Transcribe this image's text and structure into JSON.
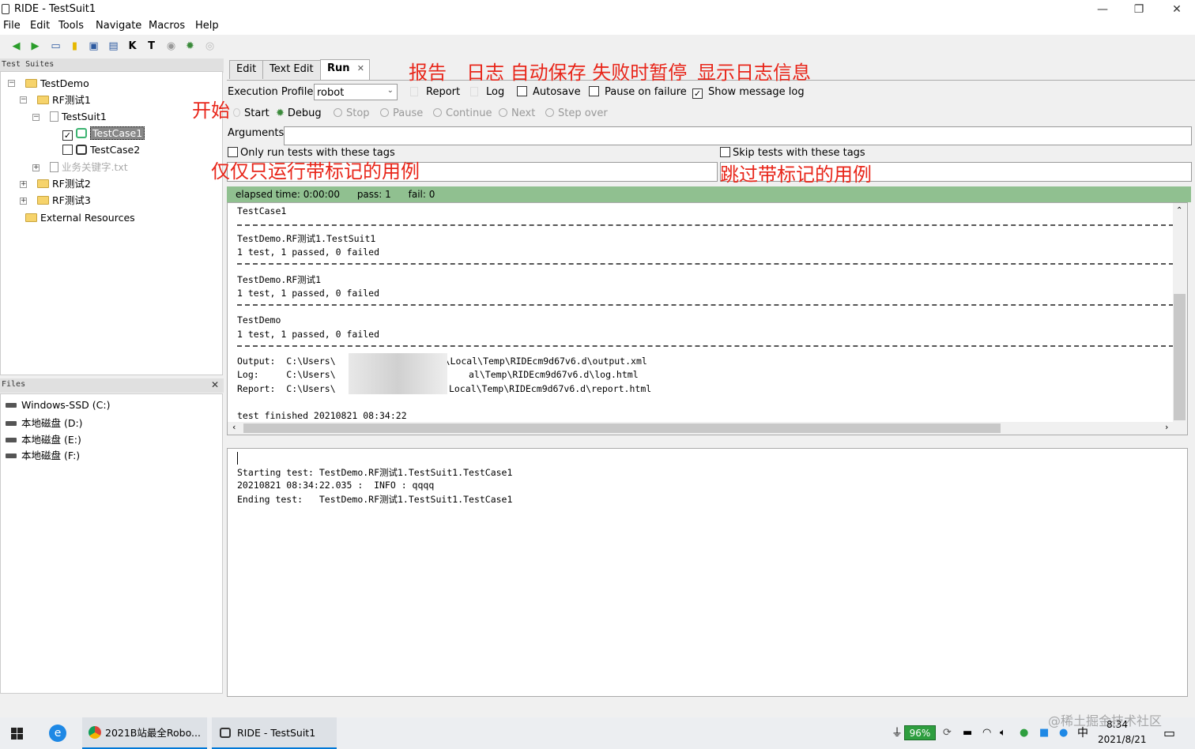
{
  "window": {
    "title": "RIDE - TestSuit1",
    "minimize": "—",
    "restore": "❐",
    "close": "✕"
  },
  "menu": [
    "File",
    "Edit",
    "Tools",
    "Navigate",
    "Macros",
    "Help"
  ],
  "left": {
    "suites_header": "Test Suites",
    "tree": {
      "testdemo": "TestDemo",
      "rf1": "RF测试1",
      "testsuit1": "TestSuit1",
      "testcase1": "TestCase1",
      "testcase2": "TestCase2",
      "keywords": "业务关键字.txt",
      "rf2": "RF测试2",
      "rf3": "RF测试3",
      "external": "External Resources"
    },
    "files_header": "Files",
    "files_close": "✕",
    "drives": [
      "Windows-SSD (C:)",
      "本地磁盘 (D:)",
      "本地磁盘 (E:)",
      "本地磁盘 (F:)"
    ]
  },
  "tabs": {
    "edit": "Edit",
    "text_edit": "Text Edit",
    "run": "Run",
    "close": "✕"
  },
  "annotations": {
    "report": "报告",
    "log_autosave_pause": "日志 自动保存 失败时暂停",
    "show_log": "显示日志信息",
    "start": "开始",
    "only_run": "仅仅只运行带标记的用例",
    "skip": "跳过带标记的用例"
  },
  "run": {
    "execution_profile_label": "Execution Profile:",
    "profile_value": "robot",
    "report": "Report",
    "log": "Log",
    "autosave": "Autosave",
    "pause_on_failure": "Pause on failure",
    "show_message_log": "Show message log",
    "start": "Start",
    "debug": "Debug",
    "stop": "Stop",
    "pause": "Pause",
    "continue": "Continue",
    "next": "Next",
    "step_over": "Step over",
    "arguments_label": "Arguments:",
    "only_run_tags": "Only run tests with these tags",
    "skip_tags": "Skip tests with these tags"
  },
  "status": {
    "elapsed": "elapsed time: 0:00:00",
    "pass": "pass: 1",
    "fail": "fail: 0"
  },
  "output": {
    "l1": "TestCase1",
    "l2": "TestDemo.RF测试1.TestSuit1",
    "l3": "1 test, 1 passed, 0 failed",
    "l4": "TestDemo.RF测试1",
    "l5": "1 test, 1 passed, 0 failed",
    "l6": "TestDemo",
    "l7": "1 test, 1 passed, 0 failed",
    "l8": "Output:  C:\\Users\\",
    "l8b": "pData\\Local\\Temp\\RIDEcm9d67v6.d\\output.xml",
    "l9": "Log:     C:\\Users\\",
    "l9b": "al\\Temp\\RIDEcm9d67v6.d\\log.html",
    "l10": "Report:  C:\\Users\\",
    "l10b": "Local\\Temp\\RIDEcm9d67v6.d\\report.html",
    "l11": "test finished 20210821 08:34:22"
  },
  "message_log": {
    "l1": "Starting test: TestDemo.RF测试1.TestSuit1.TestCase1",
    "l2": "20210821 08:34:22.035 :  INFO : qqqq",
    "l3": "Ending test:   TestDemo.RF测试1.TestSuit1.TestCase1"
  },
  "taskbar": {
    "browser_task": "2021B站最全Robo...",
    "ride_task": "RIDE - TestSuit1",
    "battery": "96%",
    "ime": "中",
    "time": "8:34",
    "date": "2021/8/21",
    "watermark": "@稀土掘金技术社区"
  },
  "colors": {
    "annotation": "#e8261a",
    "status_bg": "#90c090",
    "taskbar_accent": "#0078d7"
  }
}
